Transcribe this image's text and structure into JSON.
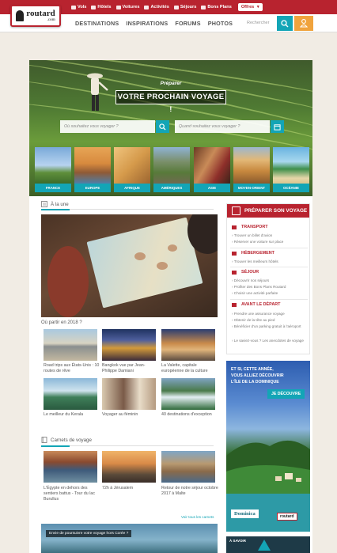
{
  "topbar": {
    "items": [
      {
        "label": "Vols",
        "icon": "plane-icon"
      },
      {
        "label": "Hôtels",
        "icon": "bed-icon"
      },
      {
        "label": "Voitures",
        "icon": "car-icon"
      },
      {
        "label": "Activités",
        "icon": "activity-icon"
      },
      {
        "label": "Séjours",
        "icon": "suitcase-icon"
      },
      {
        "label": "Bons Plans",
        "icon": "tag-icon"
      }
    ],
    "offres_label": "Offres"
  },
  "logo": {
    "name": "routard",
    "domain": ".com"
  },
  "nav": {
    "items": [
      "DESTINATIONS",
      "INSPIRATIONS",
      "FORUMS",
      "PHOTOS"
    ],
    "search_placeholder": "Rechercher"
  },
  "hero": {
    "subtitle": "Préparer",
    "title": "VOTRE PROCHAIN VOYAGE !",
    "where_placeholder": "Où souhaitez vous voyager ?",
    "when_placeholder": "Quand souhaitez vous voyager ?",
    "destinations": [
      "FRANCE",
      "EUROPE",
      "AFRIQUE",
      "AMÉRIQUES",
      "ASIE",
      "MOYEN-ORIENT",
      "OCÉANIE"
    ]
  },
  "une": {
    "label": "À la une"
  },
  "feature": {
    "subtitle": "Où partir en 2018 ?",
    "articles": [
      "Road trips aux États-Unis : 10 routes de rêve",
      "Bangkok vue par Jean-Philippe Damiani",
      "La Valette, capitale européenne de la culture",
      "Le meilleur du Kerala",
      "Voyager au féminin",
      "40 destinations d'exception"
    ]
  },
  "carnets": {
    "label": "Carnets de voyage",
    "articles": [
      "L'Égypte en dehors des sentiers battus - Tour du lac Burullus",
      "72h à Jérusalem",
      "Retour de notre séjour octobre 2017 à Malte"
    ],
    "more": "Voir tous les carnets"
  },
  "banner": {
    "text": "Envie de poursuivre votre voyage hors Corée ?"
  },
  "sidebar": {
    "title": "PRÉPARER SON VOYAGE",
    "sections": [
      {
        "heading": "TRANSPORT",
        "lines": [
          "› Trouver un billet d'avion",
          "› Réserver une voiture sur place"
        ]
      },
      {
        "heading": "HÉBERGEMENT",
        "lines": [
          "› Trouver les meilleurs hôtels"
        ]
      },
      {
        "heading": "SÉJOUR",
        "lines": [
          "› Découvrir nos séjours",
          "› Profiter des Bons Plans Routard",
          "› Choisir une activité parfaite"
        ]
      },
      {
        "heading": "AVANT LE DÉPART",
        "lines": [
          "› Prendre une assurance voyage",
          "› Obtenir de la tête au pied",
          "› Bénéficier d'un parking gratuit à l'aéroport",
          "› Le saviez-vous ? Les anecdotes de voyage"
        ]
      }
    ]
  },
  "ad": {
    "text_line1": "ET SI, CETTE ANNÉE,",
    "text_line2": "VOUS ALLIEZ DÉCOUVRIR",
    "text_line3": "L'ÎLE DE LA DOMINIQUE",
    "button": "JE DÉCOUVRE",
    "brand": "Dominica",
    "partner": "routard"
  },
  "mini_ad": {
    "text": "À SAVOIR"
  },
  "colors": {
    "brand_red": "#b8232f",
    "teal": "#13a5b6",
    "orange": "#f0a33d",
    "background": "#f1ece4"
  }
}
